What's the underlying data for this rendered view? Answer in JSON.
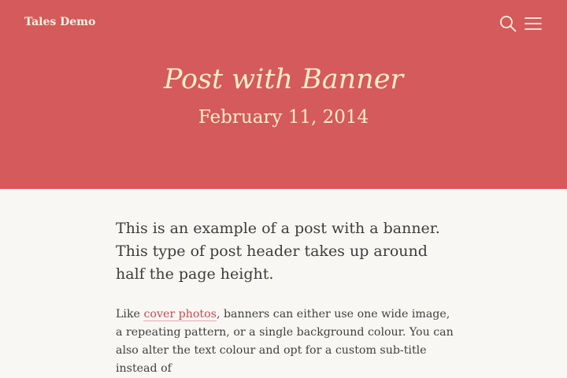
{
  "header": {
    "site_title": "Tales Demo",
    "icons": [
      "search-icon",
      "menu-icon"
    ]
  },
  "banner": {
    "background_color": "#d55a5b",
    "text_color": "#fbefc6",
    "title": "Post with Banner",
    "date": "February 11, 2014"
  },
  "post": {
    "lead": "This is an example of a post with a banner. This type of post header takes up around half the page height.",
    "body_before_link": "Like ",
    "link_text": "cover photos",
    "body_after_link": ", banners can either use one wide image, a repeating pattern, or a single background colour. You can also alter the text colour and opt for a custom sub-title instead of",
    "link_color": "#c44a55"
  }
}
